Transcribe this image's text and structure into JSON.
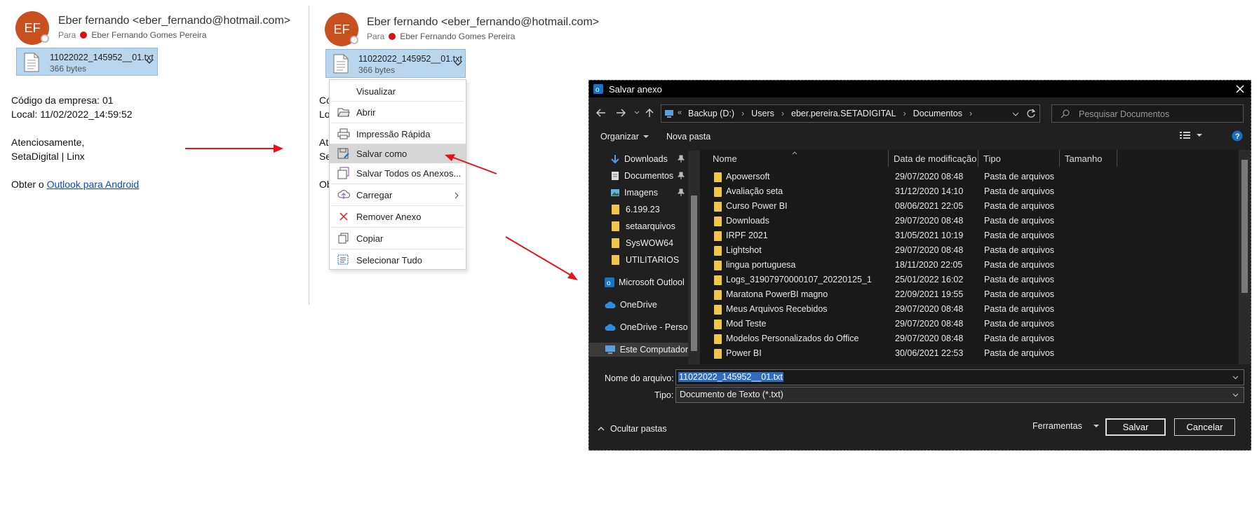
{
  "email": {
    "avatar_initials": "EF",
    "sender": "Eber fernando <eber_fernando@hotmail.com>",
    "to_label": "Para",
    "recipient": "Eber Fernando Gomes Pereira",
    "attachment": {
      "name": "11022022_145952__01.txt",
      "size": "366 bytes"
    },
    "body": {
      "line1": "Código da empresa: 01",
      "line2": "Local: 11/02/2022_14:59:52",
      "line3": "Atenciosamente,",
      "line4": "SetaDigital | Linx",
      "footer_prefix": "Obter o",
      "footer_link": "Outlook para Android"
    },
    "body_partial": {
      "p1": "Có",
      "p2": "Lo",
      "p3": "At",
      "p4": "Se",
      "p5": "Ob"
    }
  },
  "context_menu": {
    "items": [
      {
        "label": "Visualizar",
        "icon": "none"
      },
      {
        "label": "Abrir",
        "icon": "folder-open-icon"
      },
      {
        "label": "Impressão Rápida",
        "icon": "printer-icon"
      },
      {
        "label": "Salvar como",
        "icon": "save-as-icon"
      },
      {
        "label": "Salvar Todos os Anexos...",
        "icon": "save-all-icon"
      },
      {
        "label": "Carregar",
        "icon": "upload-icon"
      },
      {
        "label": "Remover Anexo",
        "icon": "remove-icon"
      },
      {
        "label": "Copiar",
        "icon": "copy-icon"
      },
      {
        "label": "Selecionar Tudo",
        "icon": "select-all-icon"
      }
    ]
  },
  "dialog": {
    "title": "Salvar anexo",
    "breadcrumb": [
      "Backup (D:)",
      "Users",
      "eber.pereira.SETADIGITAL",
      "Documentos"
    ],
    "search_placeholder": "Pesquisar Documentos",
    "toolbar": {
      "organize": "Organizar",
      "new_folder": "Nova pasta"
    },
    "nav": [
      {
        "label": "Downloads",
        "pinned": true
      },
      {
        "label": "Documentos",
        "pinned": true
      },
      {
        "label": "Imagens",
        "pinned": true
      },
      {
        "label": "6.199.23"
      },
      {
        "label": "setaarquivos"
      },
      {
        "label": "SysWOW64"
      },
      {
        "label": "UTILITARIOS"
      },
      {
        "label": "Microsoft Outlool"
      },
      {
        "label": "OneDrive"
      },
      {
        "label": "OneDrive - Persor"
      },
      {
        "label": "Este Computador"
      }
    ],
    "columns": [
      "Nome",
      "Data de modificação",
      "Tipo",
      "Tamanho"
    ],
    "files": [
      {
        "name": "Apowersoft",
        "date": "29/07/2020 08:48",
        "type": "Pasta de arquivos"
      },
      {
        "name": "Avaliação seta",
        "date": "31/12/2020 14:10",
        "type": "Pasta de arquivos"
      },
      {
        "name": "Curso Power BI",
        "date": "08/06/2021 22:05",
        "type": "Pasta de arquivos"
      },
      {
        "name": "Downloads",
        "date": "29/07/2020 08:48",
        "type": "Pasta de arquivos"
      },
      {
        "name": "IRPF 2021",
        "date": "31/05/2021 10:19",
        "type": "Pasta de arquivos"
      },
      {
        "name": "Lightshot",
        "date": "29/07/2020 08:48",
        "type": "Pasta de arquivos"
      },
      {
        "name": "lingua portuguesa",
        "date": "18/11/2020 22:05",
        "type": "Pasta de arquivos"
      },
      {
        "name": "Logs_31907970000107_20220125_1",
        "date": "25/01/2022 16:02",
        "type": "Pasta de arquivos"
      },
      {
        "name": "Maratona PowerBI magno",
        "date": "22/09/2021 19:55",
        "type": "Pasta de arquivos"
      },
      {
        "name": "Meus Arquivos Recebidos",
        "date": "29/07/2020 08:48",
        "type": "Pasta de arquivos"
      },
      {
        "name": "Mod Teste",
        "date": "29/07/2020 08:48",
        "type": "Pasta de arquivos"
      },
      {
        "name": "Modelos Personalizados do Office",
        "date": "29/07/2020 08:48",
        "type": "Pasta de arquivos"
      },
      {
        "name": "Power BI",
        "date": "30/06/2021 22:53",
        "type": "Pasta de arquivos"
      }
    ],
    "filename_label": "Nome do arquivo:",
    "filename_value": "11022022_145952__01.txt",
    "type_label": "Tipo:",
    "type_value": "Documento de Texto (*.txt)",
    "hide_folders": "Ocultar pastas",
    "tools": "Ferramentas",
    "save": "Salvar",
    "cancel": "Cancelar"
  },
  "colors": {
    "arrow": "#e0141a",
    "attachment_bg": "#b8d6ee",
    "dialog_bg": "#202020",
    "avatar": "#c8501e"
  }
}
